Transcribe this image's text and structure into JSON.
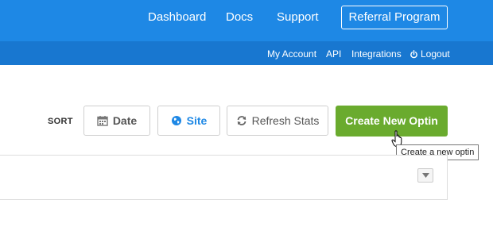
{
  "top_nav": {
    "items": [
      {
        "label": "Dashboard"
      },
      {
        "label": "Docs"
      },
      {
        "label": "Support"
      }
    ],
    "referral_label": "Referral Program"
  },
  "sub_nav": {
    "items": [
      {
        "label": "My Account"
      },
      {
        "label": "API"
      },
      {
        "label": "Integrations"
      }
    ],
    "logout_label": "Logout",
    "logout_icon": "power-icon"
  },
  "sort": {
    "label": "SORT",
    "buttons": [
      {
        "label": "Date",
        "icon": "calendar-icon",
        "color": "#555555"
      },
      {
        "label": "Site",
        "icon": "globe-icon",
        "color": "#1e88e5"
      },
      {
        "label": "Refresh Stats",
        "icon": "refresh-icon",
        "color": "#555555"
      }
    ]
  },
  "create_button": {
    "label": "Create New Optin",
    "tooltip": "Create a new optin"
  },
  "colors": {
    "topbar": "#1e88e5",
    "subbar": "#1877d0",
    "accent_green": "#6aab2e"
  }
}
